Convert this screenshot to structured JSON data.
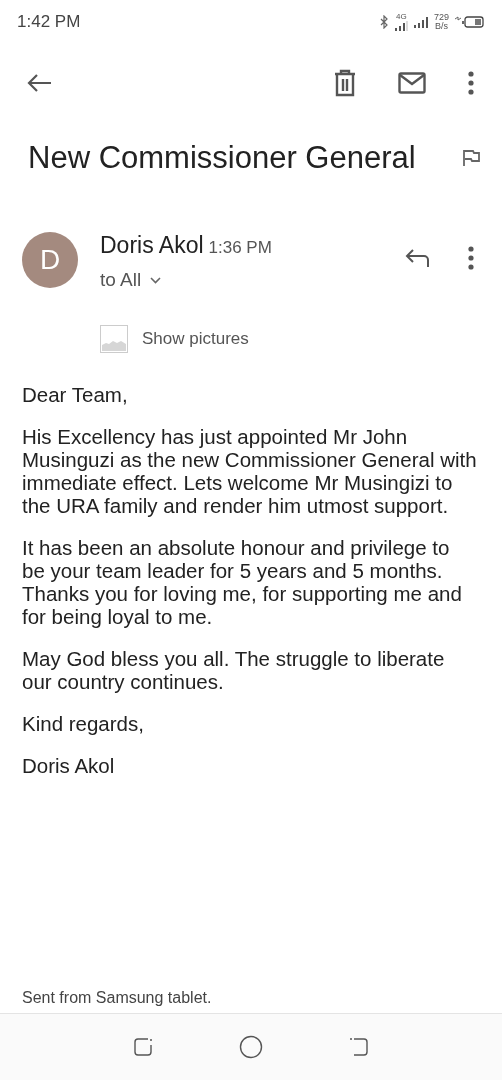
{
  "status_bar": {
    "time": "1:42 PM",
    "network": "4G",
    "speed_value": "729",
    "speed_unit": "B/s"
  },
  "subject": "New Commissioner General",
  "message": {
    "avatar_letter": "D",
    "sender": "Doris Akol",
    "time": "1:36 PM",
    "recipients": "to All",
    "show_pictures": "Show pictures",
    "paragraphs": [
      "Dear Team,",
      "His Excellency has just appointed Mr John Musinguzi as the new Commissioner General with immediate effect. Lets welcome Mr Musingizi to the URA family and render him utmost support.",
      "It has been an absolute honour and privilege to be your team leader for 5 years and 5 months. Thanks you for loving me, for supporting me and for being loyal to me.",
      "May God bless you all. The struggle to liberate our country continues.",
      "Kind regards,",
      "Doris Akol"
    ],
    "signature": "Sent from Samsung tablet."
  }
}
